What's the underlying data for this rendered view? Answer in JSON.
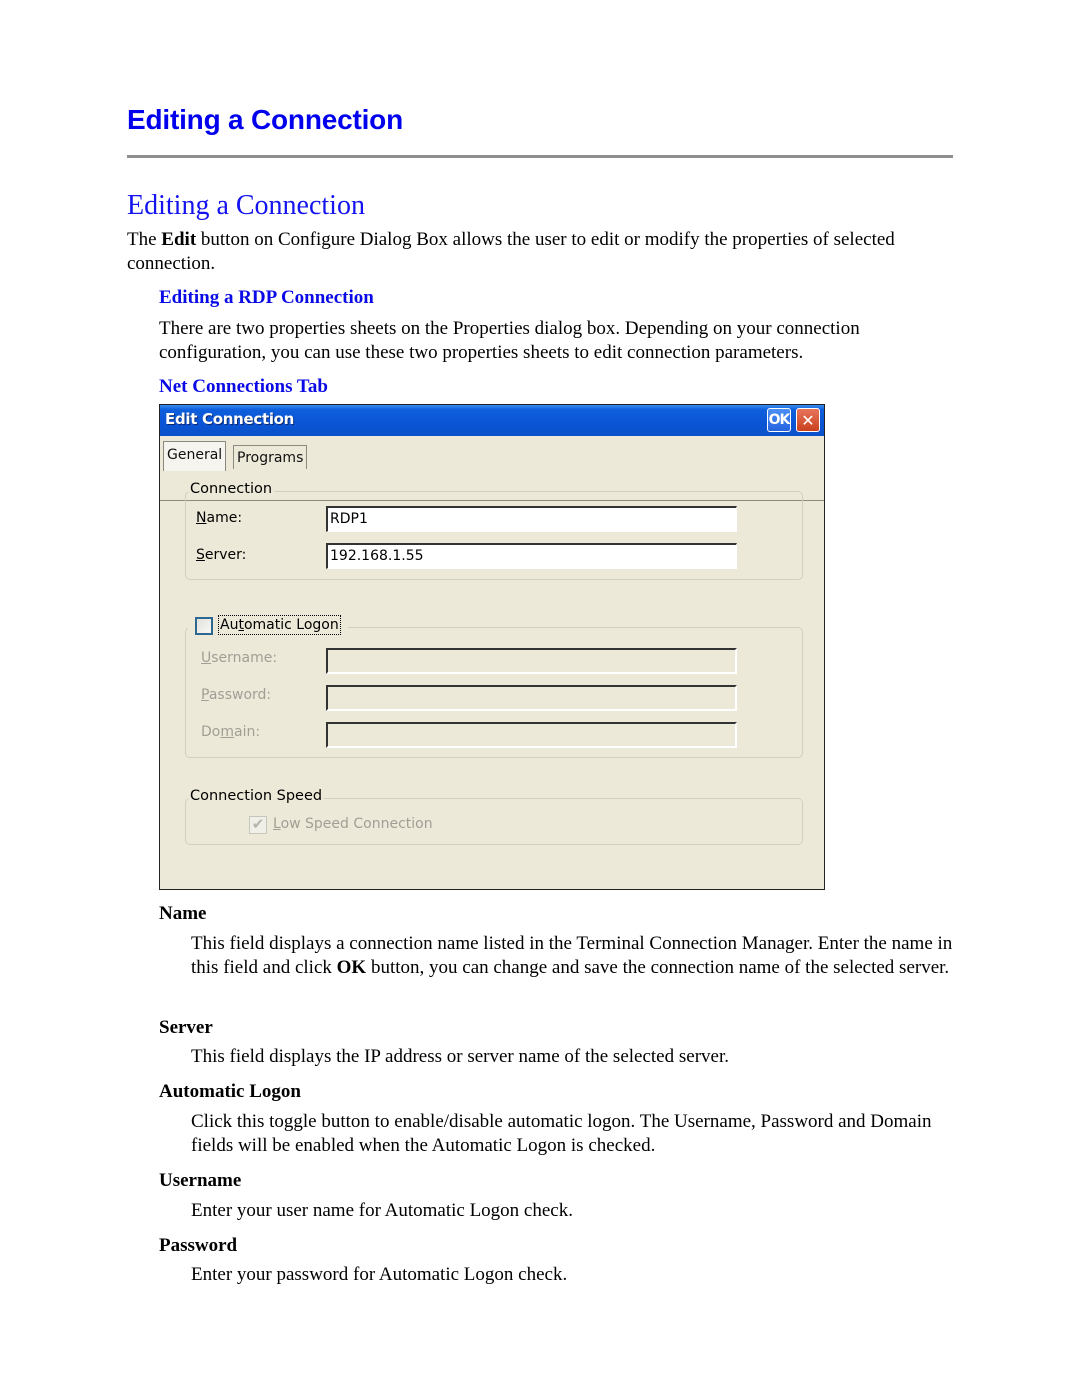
{
  "page": {
    "heading": "Editing a Connection",
    "section_title": "Editing a Connection",
    "intro": {
      "before": "The ",
      "bold": "Edit",
      "after": " button on Configure Dialog Box allows the user to edit or modify the properties of selected connection."
    },
    "subsection_title": "Editing a RDP Connection",
    "subsection_text": "There are two properties sheets on the Properties dialog box. Depending on your connection configuration, you can use these two properties sheets to edit connection parameters.",
    "tab_heading": "Net Connections Tab"
  },
  "dialog": {
    "title": "Edit Connection",
    "ok_label": "OK",
    "close_glyph": "✕",
    "tabs": [
      {
        "label": "General",
        "active": true
      },
      {
        "label": "Programs",
        "active": false
      }
    ],
    "connection_group": {
      "legend": "Connection",
      "name_label_u": "N",
      "name_label_rest": "ame:",
      "name_value": "RDP1",
      "server_label_u": "S",
      "server_label_rest": "erver:",
      "server_value": "192.168.1.55"
    },
    "logon_group": {
      "checkbox_label_pre": "Au",
      "checkbox_label_u": "t",
      "checkbox_label_rest": "omatic Logon",
      "checked": false,
      "username_label_u": "U",
      "username_label_rest": "sername:",
      "username_value": "",
      "password_label_u": "P",
      "password_label_rest": "assword:",
      "password_value": "",
      "domain_label_pre": "Do",
      "domain_label_u": "m",
      "domain_label_rest": "ain:",
      "domain_value": ""
    },
    "speed_group": {
      "legend": "Connection Speed",
      "checkbox_label_u": "L",
      "checkbox_label_rest": "ow Speed Connection",
      "checked": true,
      "check_glyph": "✔"
    }
  },
  "definitions": {
    "name": {
      "term": "Name",
      "text_before": "This field displays a connection name listed in the Terminal Connection Manager. Enter the name in this field and click ",
      "text_bold": "OK",
      "text_after": " button, you can change and save the connection name of the selected server."
    },
    "server": {
      "term": "Server",
      "text": "This field displays the IP address or server name of the selected server."
    },
    "automatic_logon": {
      "term": "Automatic Logon",
      "text": "Click this toggle button to enable/disable automatic logon. The Username, Password and Domain fields will be enabled when the Automatic Logon is checked."
    },
    "username": {
      "term": "Username",
      "text": "Enter your user name for Automatic Logon check."
    },
    "password": {
      "term": "Password",
      "text": "Enter your password for Automatic Logon check."
    }
  }
}
